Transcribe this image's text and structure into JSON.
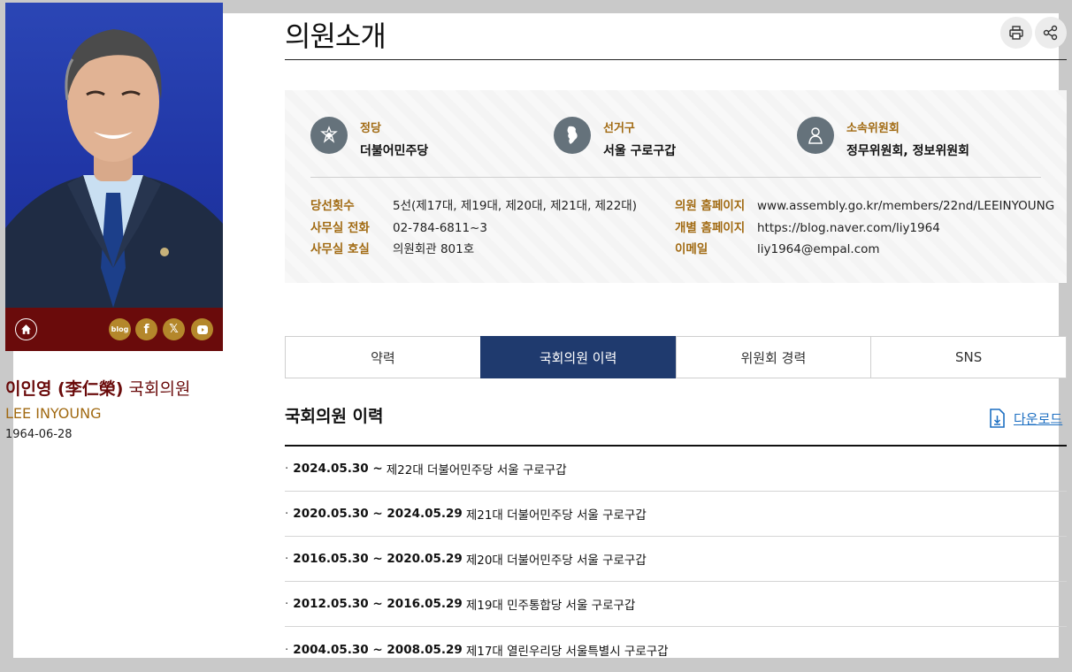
{
  "page": {
    "title": "의원소개"
  },
  "profile": {
    "name_ko": "이인영 (李仁榮)",
    "role": "국회의원",
    "name_en": "LEE INYOUNG",
    "birth": "1964-06-28",
    "sns": {
      "blog": "blog"
    }
  },
  "info": {
    "party_label": "정당",
    "party": "더불어민주당",
    "district_label": "선거구",
    "district": "서울 구로구갑",
    "committee_label": "소속위원회",
    "committee": "정무위원회, 정보위원회",
    "details_left": [
      {
        "key": "당선횟수",
        "value": "5선(제17대, 제19대, 제20대, 제21대, 제22대)"
      },
      {
        "key": "사무실 전화",
        "value": "02-784-6811~3"
      },
      {
        "key": "사무실 호실",
        "value": "의원회관 801호"
      }
    ],
    "details_right": [
      {
        "key": "의원 홈페이지",
        "value": "www.assembly.go.kr/members/22nd/LEEINYOUNG"
      },
      {
        "key": "개별 홈페이지",
        "value": "https://blog.naver.com/liy1964"
      },
      {
        "key": "이메일",
        "value": "liy1964@empal.com"
      }
    ]
  },
  "tabs": [
    {
      "label": "약력",
      "active": false
    },
    {
      "label": "국회의원 이력",
      "active": true
    },
    {
      "label": "위원회 경력",
      "active": false
    },
    {
      "label": "SNS",
      "active": false
    }
  ],
  "history": {
    "title": "국회의원 이력",
    "download_label": "다운로드",
    "items": [
      {
        "date": "2024.05.30 ~",
        "desc": "제22대 더불어민주당 서울 구로구갑"
      },
      {
        "date": "2020.05.30 ~ 2024.05.29",
        "desc": "제21대 더불어민주당 서울 구로구갑"
      },
      {
        "date": "2016.05.30 ~ 2020.05.29",
        "desc": "제20대 더불어민주당 서울 구로구갑"
      },
      {
        "date": "2012.05.30 ~ 2016.05.29",
        "desc": "제19대 민주통합당 서울 구로구갑"
      },
      {
        "date": "2004.05.30 ~ 2008.05.29",
        "desc": "제17대 열린우리당 서울특별시 구로구갑"
      }
    ]
  },
  "colors": {
    "accent": "#1f3a6e",
    "gold": "#a16a12",
    "maroon": "#6a0b0b",
    "link": "#1d6fc2"
  }
}
